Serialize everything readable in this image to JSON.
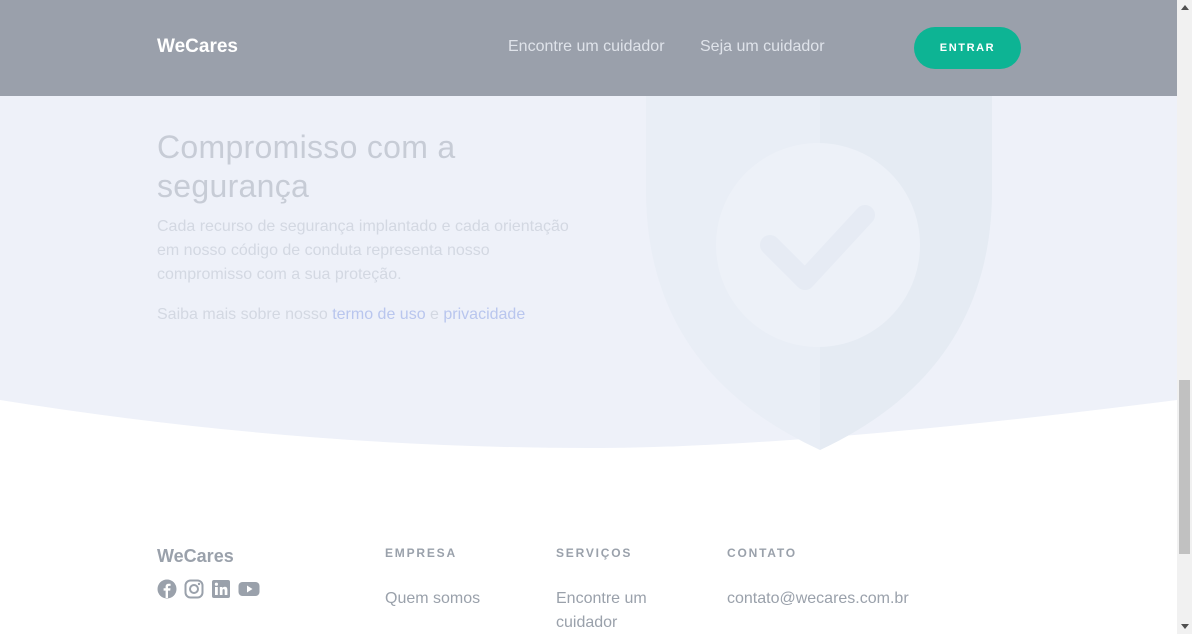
{
  "header": {
    "brand": "WeCares",
    "nav": [
      "Encontre um cuidador",
      "Seja um cuidador"
    ],
    "cta_label": "ENTRAR"
  },
  "hero": {
    "title": "Compromisso com a segurança",
    "description": "Cada recurso de segurança implantado e cada orientação em nosso código de conduta representa nosso compromisso com a sua proteção.",
    "more_prefix": "Saiba mais sobre nosso ",
    "terms_link": "termo de uso",
    "conjunction": " e ",
    "privacy_link": "privacidade"
  },
  "footer": {
    "brand": "WeCares",
    "socials": [
      "facebook-icon",
      "instagram-icon",
      "linkedin-icon",
      "youtube-icon"
    ],
    "columns": [
      {
        "title": "EMPRESA",
        "link": "Quem somos"
      },
      {
        "title": "SERVIÇOS",
        "link": "Encontre um cuidador"
      },
      {
        "title": "CONTATO",
        "link": "contato@wecares.com.br"
      }
    ]
  },
  "colors": {
    "accent": "#0db494",
    "header_bg": "#9aa0ab",
    "hero_bg": "#eef1f9",
    "footer_text": "#9aa1ab"
  }
}
